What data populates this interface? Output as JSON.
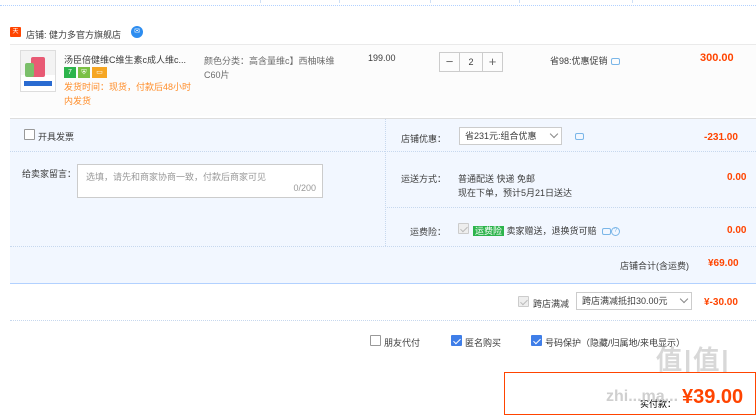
{
  "shop": {
    "tag": "天猫",
    "name": "店铺: 健力多官方旗舰店",
    "ww_icon": "wangwang-chat-icon"
  },
  "item": {
    "title": "汤臣倍健维C维生素c成人维c...",
    "badges": [
      "7",
      "shield",
      "card"
    ],
    "ship_note": "发货时间：现货，付款后48小时内发货",
    "sku": "颜色分类：高含量维c】西柚味维C60片",
    "unit_price": "199.00",
    "quantity": "2",
    "minus": "−",
    "plus": "+",
    "promo": "省98:优惠促销",
    "subtotal": "300.00"
  },
  "invoice": {
    "label": "开具发票"
  },
  "memo": {
    "label": "给卖家留言：",
    "placeholder": "选填，请先和商家协商一致，付款后商家可见",
    "counter": "0/200"
  },
  "discount": {
    "label": "店铺优惠：",
    "selected": "省231元:组合优惠",
    "value": "-231.00"
  },
  "delivery": {
    "label": "运送方式：",
    "line1": "普通配送 快递 免邮",
    "line2": "现在下单，预计5月21日送达",
    "value": "0.00"
  },
  "insurance": {
    "label": "运费险：",
    "tag": "运费险",
    "text": "卖家赠送，退换货可赔",
    "value": "0.00"
  },
  "shop_total": {
    "label": "店铺合计(含运费)",
    "value": "¥69.00"
  },
  "cross_store": {
    "label": "跨店满减",
    "selected": "跨店满减抵扣30.00元",
    "value": "¥-30.00"
  },
  "options": [
    {
      "label": "朋友代付",
      "checked": false
    },
    {
      "label": "匿名购买",
      "checked": true
    },
    {
      "label": "号码保护（隐藏/归属地/来电显示）",
      "checked": true
    }
  ],
  "final": {
    "label": "实付款：",
    "value": "¥39.00",
    "watermark": "值|值|值",
    "watermark_url": "zhi...ma..."
  },
  "colors": {
    "accent": "#ff4400",
    "blue_bg": "#f2f7ff",
    "link_blue": "#3f7ee8"
  }
}
